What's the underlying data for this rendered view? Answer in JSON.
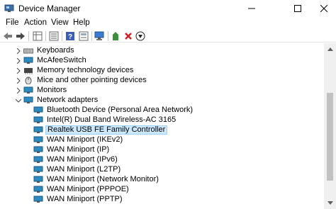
{
  "window": {
    "title": "Device Manager"
  },
  "menu": [
    "File",
    "Action",
    "View",
    "Help"
  ],
  "toolbar_buttons": [
    "back-arrow-icon",
    "forward-arrow-icon",
    "properties-grid-icon",
    "properties-list-icon",
    "help-icon",
    "show-hidden-icon",
    "scan-hardware-icon",
    "update-driver-icon",
    "uninstall-x-icon",
    "disable-device-icon"
  ],
  "tree": {
    "categories_top": [
      {
        "label": "Keyboards",
        "icon": "keyboard-icon"
      },
      {
        "label": "McAfeeSwitch",
        "icon": "network-icon"
      },
      {
        "label": "Memory technology devices",
        "icon": "memory-icon"
      },
      {
        "label": "Mice and other pointing devices",
        "icon": "mouse-icon"
      },
      {
        "label": "Monitors",
        "icon": "monitor-icon"
      }
    ],
    "expanded_category": {
      "label": "Network adapters",
      "icon": "network-adapter-icon"
    },
    "adapters": [
      "Bluetooth Device (Personal Area Network)",
      "Intel(R) Dual Band Wireless-AC 3165",
      "Realtek USB FE Family Controller",
      "WAN Miniport (IKEv2)",
      "WAN Miniport (IP)",
      "WAN Miniport (IPv6)",
      "WAN Miniport (L2TP)",
      "WAN Miniport (Network Monitor)",
      "WAN Miniport (PPPOE)",
      "WAN Miniport (PPTP)"
    ],
    "selected_adapter": "Realtek USB FE Family Controller"
  },
  "colors": {
    "selection_bg": "#cce8ff",
    "selection_border": "#99d1ff",
    "adapter_icon": "#2e8bc0",
    "delete_red": "#d42020"
  }
}
